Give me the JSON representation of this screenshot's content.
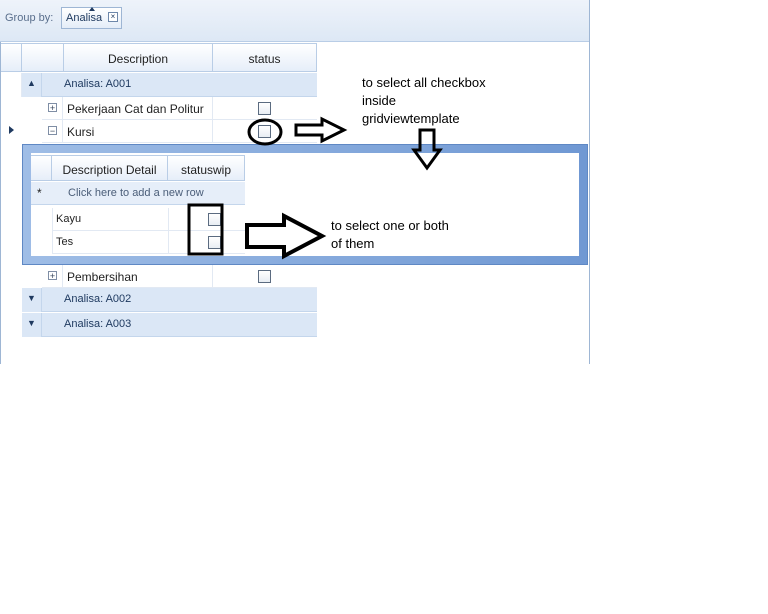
{
  "groupby": {
    "label": "Group by:",
    "chip": "Analisa",
    "close": "×"
  },
  "columns": {
    "description": "Description",
    "status": "status"
  },
  "groups": [
    {
      "label": "Analisa: A001"
    },
    {
      "label": "Analisa: A002"
    },
    {
      "label": "Analisa: A003"
    }
  ],
  "rows": [
    {
      "label": "Pekerjaan Cat dan Politur"
    },
    {
      "label": "Kursi"
    },
    {
      "label": "Pembersihan"
    }
  ],
  "detail": {
    "columns": {
      "description": "Description Detail",
      "status": "statuswip"
    },
    "new_row_text": "Click here to add a new row",
    "rows": [
      {
        "label": "Kayu"
      },
      {
        "label": "Tes"
      }
    ]
  },
  "annotations": {
    "top": "to select all checkbox\ninside\ngridviewtemplate",
    "middle": "to select one or both\nof them"
  },
  "colors": {
    "accent": "#6f98d3",
    "group_row": "#dbe7f6",
    "header": "#e6eef9"
  }
}
